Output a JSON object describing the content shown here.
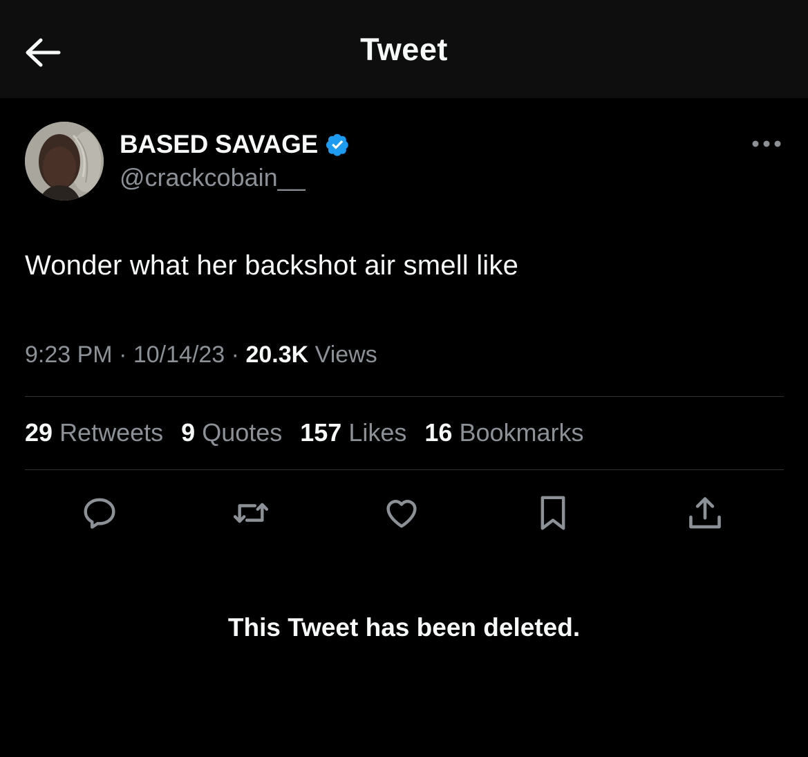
{
  "header": {
    "back_icon": "arrow-left-icon",
    "title": "Tweet"
  },
  "author": {
    "name": "BASED SAVAGE",
    "handle": "@crackcobain__",
    "verified": true,
    "verified_color": "#1d9bf0"
  },
  "tweet": {
    "text": "Wonder what her backshot air smell like",
    "time": "9:23 PM",
    "separator": "·",
    "date": "10/14/23",
    "views_count": "20.3K",
    "views_label": "Views"
  },
  "stats": [
    {
      "count": "29",
      "label": "Retweets"
    },
    {
      "count": "9",
      "label": "Quotes"
    },
    {
      "count": "157",
      "label": "Likes"
    },
    {
      "count": "16",
      "label": "Bookmarks"
    }
  ],
  "actions": [
    "reply-icon",
    "retweet-icon",
    "like-icon",
    "bookmark-icon",
    "share-icon"
  ],
  "notice": "This Tweet has been deleted.",
  "colors": {
    "background": "#000000",
    "header_bg": "#0e0e0e",
    "primary_text": "#f7f9f9",
    "secondary_text": "#8b9197",
    "divider": "#2f3336"
  }
}
